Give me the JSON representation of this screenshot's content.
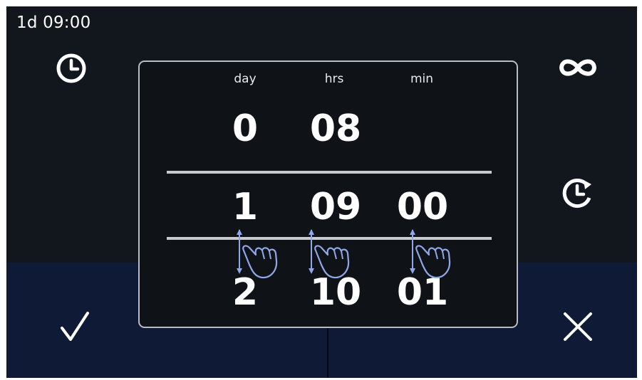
{
  "status": {
    "duration": "1d 09:00"
  },
  "picker": {
    "columns": [
      {
        "label": "day",
        "prev": "0",
        "current": "1",
        "next": "2"
      },
      {
        "label": "hrs",
        "prev": "08",
        "current": "09",
        "next": "10"
      },
      {
        "label": "min",
        "prev": "",
        "current": "00",
        "next": "01"
      }
    ]
  },
  "buttons": {
    "left_top": "clock-icon",
    "right_top": "infinity-icon",
    "right_middle": "clock-rotate-icon",
    "confirm": "check-icon",
    "cancel": "close-icon"
  },
  "colors": {
    "background": "#12161d",
    "bottom_bar": "#0f1b36",
    "dialog_border": "#b8bcc4",
    "hint_color": "#8fa8e8"
  }
}
